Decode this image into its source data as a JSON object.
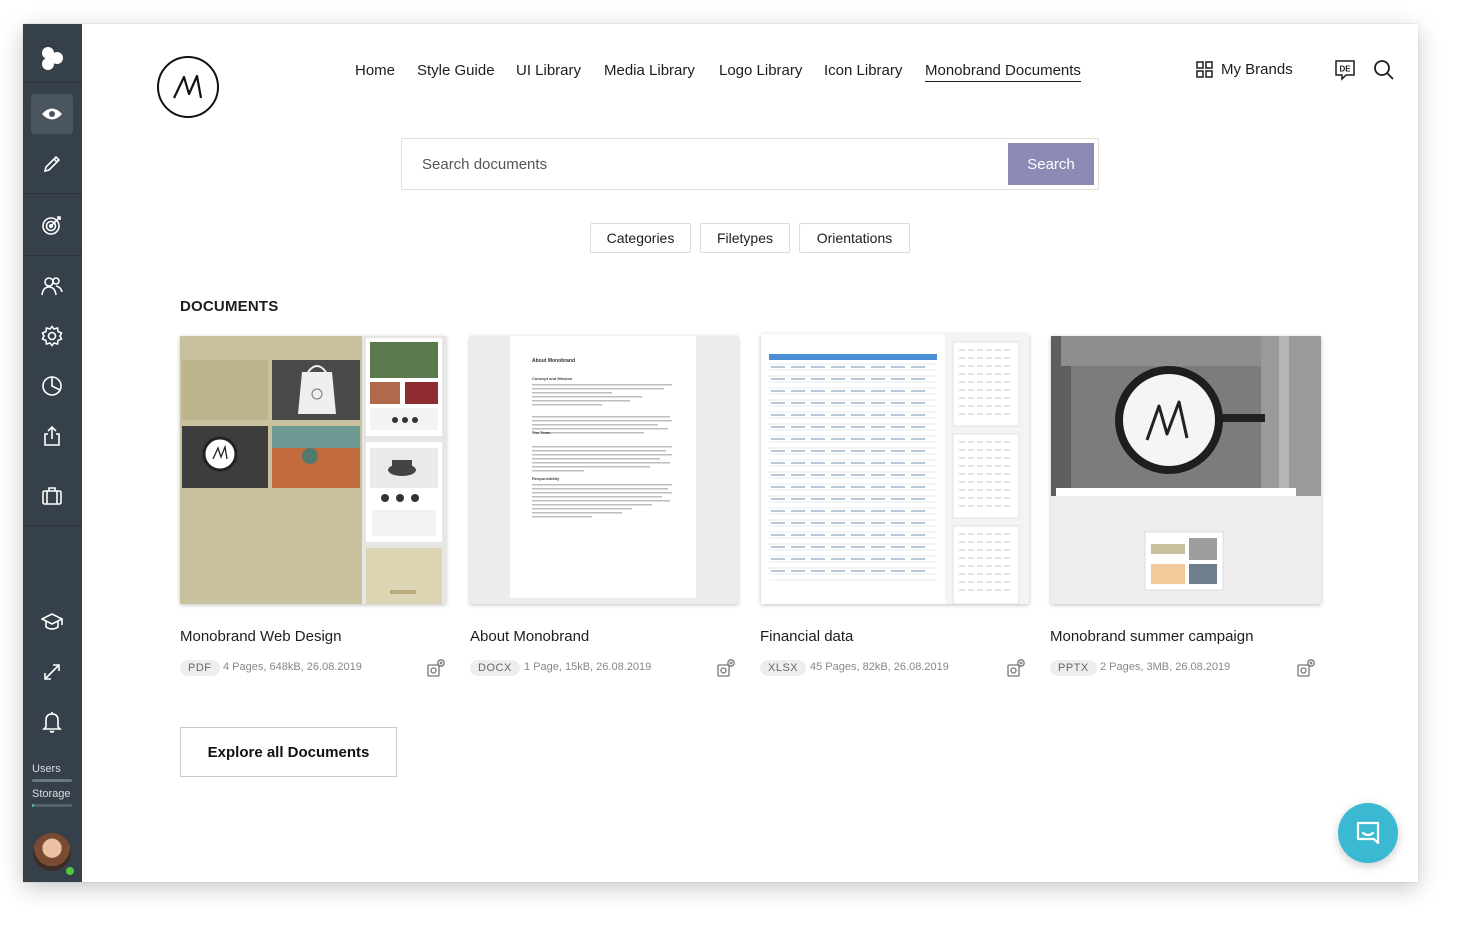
{
  "nav": {
    "items": [
      "Home",
      "Style Guide",
      "UI Library",
      "Media Library",
      "Logo Library",
      "Icon Library",
      "Monobrand Documents"
    ],
    "active": "Monobrand Documents",
    "my_brands": "My Brands",
    "language_icon_text": "DE"
  },
  "search": {
    "placeholder": "Search documents",
    "button_label": "Search"
  },
  "filters": [
    "Categories",
    "Filetypes",
    "Orientations"
  ],
  "section_title": "DOCUMENTS",
  "documents": [
    {
      "title": "Monobrand Web Design",
      "filetype": "PDF",
      "meta": "4 Pages, 648kB, 26.08.2019"
    },
    {
      "title": "About Monobrand",
      "filetype": "DOCX",
      "meta": "1 Page, 15kB, 26.08.2019"
    },
    {
      "title": "Financial data",
      "filetype": "XLSX",
      "meta": "45 Pages, 82kB, 26.08.2019"
    },
    {
      "title": "Monobrand summer campaign",
      "filetype": "PPTX",
      "meta": "2 Pages, 3MB, 26.08.2019"
    }
  ],
  "doc_preview": {
    "heading": "About Monobrand",
    "sub1": "Concept and Mission",
    "sub2": "The Team",
    "sub3": "Responsibility"
  },
  "explore_button": "Explore all Documents",
  "sidebar": {
    "users_label": "Users",
    "storage_label": "Storage",
    "users_fill": 1.0,
    "storage_fill": 0.05
  },
  "colors": {
    "sidebar": "#36404a",
    "search_button": "#8b8bb6",
    "chat_button": "#3bb9d3"
  }
}
